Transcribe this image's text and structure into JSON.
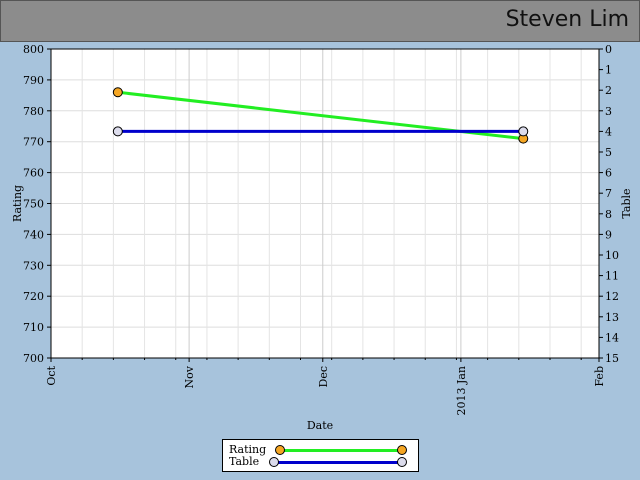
{
  "header": {
    "player_name": "Steven Lim",
    "background": "#8c8c8c"
  },
  "chart_data": {
    "type": "line",
    "title": "",
    "xlabel": "Date",
    "ylabel_left": "Rating",
    "ylabel_right": "Table",
    "x_range": [
      "2012-10-01",
      "2013-02-01"
    ],
    "x_ticks": [
      {
        "date": "2012-10-01",
        "label": "Oct"
      },
      {
        "date": "2012-11-01",
        "label": "Nov"
      },
      {
        "date": "2012-12-01",
        "label": "Dec"
      },
      {
        "date": "2013-01-01",
        "label": "2013 Jan"
      },
      {
        "date": "2013-02-01",
        "label": "Feb"
      }
    ],
    "ylim_left": [
      700,
      800
    ],
    "yticks_left": [
      700,
      710,
      720,
      730,
      740,
      750,
      760,
      770,
      780,
      790,
      800
    ],
    "ylim_right": [
      15,
      0
    ],
    "yticks_right": [
      0,
      1,
      2,
      3,
      4,
      5,
      6,
      7,
      8,
      9,
      10,
      11,
      12,
      13,
      14,
      15
    ],
    "grid": true,
    "legend_position": "bottom-center",
    "series": [
      {
        "name": "Rating",
        "axis": "left",
        "color": "#22ee22",
        "marker_color": "#f5a623",
        "points": [
          {
            "date": "2012-10-16",
            "value": 786
          },
          {
            "date": "2013-01-15",
            "value": 771
          }
        ]
      },
      {
        "name": "Table",
        "axis": "right",
        "color": "#0000cc",
        "marker_color": "#dcdcec",
        "points": [
          {
            "date": "2012-10-16",
            "value": 4
          },
          {
            "date": "2013-01-15",
            "value": 4
          }
        ]
      }
    ]
  }
}
